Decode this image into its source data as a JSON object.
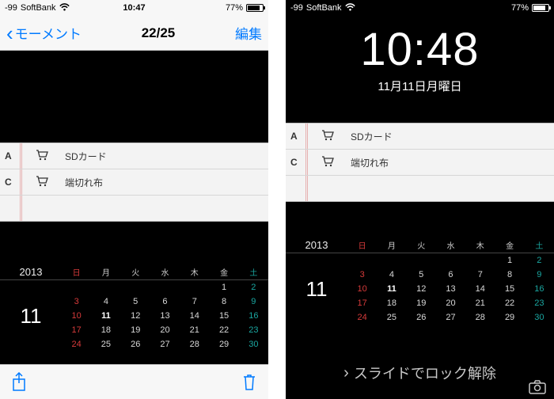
{
  "status": {
    "signal": "-99",
    "carrier": "SoftBank",
    "time_left": "10:47",
    "battery_pct": "77%"
  },
  "left": {
    "nav": {
      "back": "モーメント",
      "title": "22/25",
      "edit": "編集"
    },
    "list": {
      "rows": [
        {
          "prio": "A",
          "label": "SDカード"
        },
        {
          "prio": "C",
          "label": "端切れ布"
        }
      ]
    }
  },
  "right": {
    "lock_time": "10:48",
    "lock_date": "11月11日月曜日",
    "slide": "スライドでロック解除"
  },
  "calendar": {
    "year": "2013",
    "month": "11",
    "days": [
      "日",
      "月",
      "火",
      "水",
      "木",
      "金",
      "土"
    ],
    "weeks": [
      [
        "",
        "",
        "",
        "",
        "",
        "1",
        "2"
      ],
      [
        "3",
        "4",
        "5",
        "6",
        "7",
        "8",
        "9"
      ],
      [
        "10",
        "11",
        "12",
        "13",
        "14",
        "15",
        "16"
      ],
      [
        "17",
        "18",
        "19",
        "20",
        "21",
        "22",
        "23"
      ],
      [
        "24",
        "25",
        "26",
        "27",
        "28",
        "29",
        "30"
      ]
    ],
    "today_col": 1,
    "today_row": 2
  }
}
